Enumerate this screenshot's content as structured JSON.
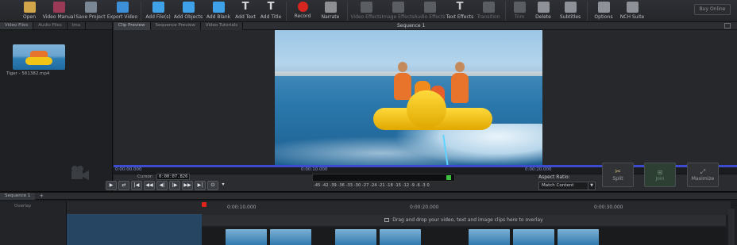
{
  "toolbar": {
    "buttons": [
      {
        "label": "Open",
        "icon": "folder-open-icon",
        "color": "#d1a64a"
      },
      {
        "label": "Video Manual",
        "icon": "manual-icon",
        "color": "#9b3a56"
      },
      {
        "label": "Save Project",
        "icon": "save-icon",
        "color": "#7b8694"
      },
      {
        "label": "Export Video",
        "icon": "export-icon",
        "color": "#3d8fd8"
      },
      {
        "label": "Add File(s)",
        "icon": "add-file-icon",
        "color": "#3fa2e8"
      },
      {
        "label": "Add Objects",
        "icon": "add-objects-icon",
        "color": "#3fa2e8"
      },
      {
        "label": "Add Blank",
        "icon": "add-blank-icon",
        "color": "#3fa2e8"
      },
      {
        "label": "Add Text",
        "icon": "add-text-icon",
        "color": "#d8d8d8"
      },
      {
        "label": "Add Title",
        "icon": "add-title-icon",
        "color": "#d8d8d8"
      },
      {
        "label": "Record",
        "icon": "record-icon",
        "color": "#d6261f"
      },
      {
        "label": "Narrate",
        "icon": "narrate-icon",
        "color": "#8d8f93"
      },
      {
        "label": "Video Effects",
        "icon": "video-effects-icon",
        "color": "#5a5d62"
      },
      {
        "label": "Image Effects",
        "icon": "image-effects-icon",
        "color": "#5a5d62"
      },
      {
        "label": "Audio Effects",
        "icon": "audio-effects-icon",
        "color": "#5a5d62"
      },
      {
        "label": "Text Effects",
        "icon": "text-effects-icon",
        "color": "#c9c9c9"
      },
      {
        "label": "Transition",
        "icon": "transition-icon",
        "color": "#5a5d62"
      },
      {
        "label": "Trim",
        "icon": "trim-icon",
        "color": "#5a5d62"
      },
      {
        "label": "Delete",
        "icon": "delete-icon",
        "color": "#8e9298"
      },
      {
        "label": "Subtitles",
        "icon": "subtitles-icon",
        "color": "#8e9298"
      },
      {
        "label": "Options",
        "icon": "options-icon",
        "color": "#8e9298"
      },
      {
        "label": "NCH Suite",
        "icon": "nch-suite-icon",
        "color": "#8e9298"
      }
    ],
    "buy_online": "Buy Online"
  },
  "left_panel": {
    "tabs": [
      "Video Files",
      "Audio Files",
      "Ima"
    ],
    "file_caption": "Tiger - 561382.mp4",
    "camera_icon": "video-camera-icon"
  },
  "preview": {
    "tabs": [
      "Clip Preview",
      "Sequence Preview",
      "Video Tutorials"
    ],
    "sequence_title": "Sequence 1",
    "ruler_labels": [
      "0:00:00.000",
      "0:00:10.000",
      "0:00:20.000"
    ],
    "cursor_label": "Cursor:",
    "cursor_value": "0:00:07.826",
    "meter_scale": "-45 -42 -39 -36 -33 -30 -27 -24 -21 -18 -15 -12 -9 -6 -3 0",
    "aspect_label": "Aspect Ratio:",
    "aspect_value": "Match Content",
    "split_label": "Split",
    "join_label": "Join",
    "maximize_label": "Maximize"
  },
  "timeline": {
    "tab": "Sequence 1",
    "add_tab": "+",
    "track_name": "Overlay",
    "ruler_labels": [
      "0:00:10.000",
      "0:00:20.000",
      "0:00:30.000"
    ],
    "overlay_hint": "Drag and drop your video, text and image clips here to overlay"
  },
  "colors": {
    "accent_blue": "#3c4bd0",
    "record_red": "#e2231a",
    "meter_green": "#3fbf3f"
  }
}
